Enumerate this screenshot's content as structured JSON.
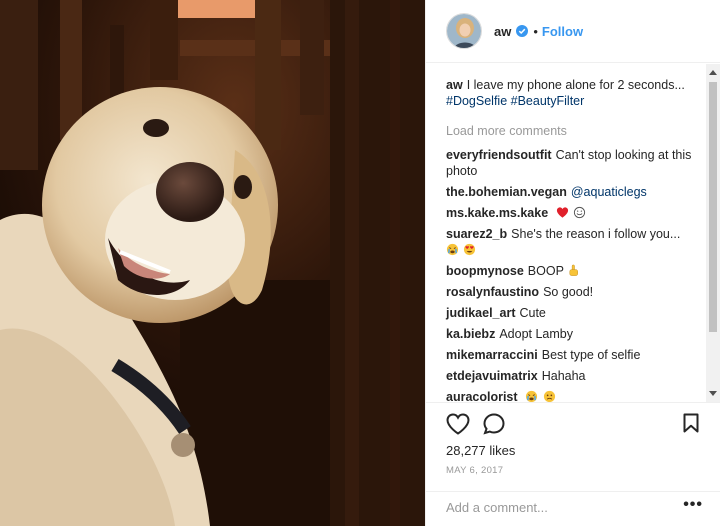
{
  "post": {
    "username": "aw",
    "follow_label": "Follow",
    "dot": "•",
    "caption_user": "aw",
    "caption_text": "I leave my phone alone for 2 seconds...",
    "hashtags": [
      "#DogSelfie",
      "#BeautyFilter"
    ],
    "load_more": "Load more comments",
    "likes": "28,277 likes",
    "date": "MAY 6, 2017",
    "add_comment_placeholder": "Add a comment...",
    "more_options": "•••"
  },
  "comments": [
    {
      "user": "everyfriendsoutfit",
      "text": "Can't stop looking at this photo"
    },
    {
      "user": "the.bohemian.vegan",
      "mention": "@aquaticlegs"
    },
    {
      "user": "ms.kake.ms.kake",
      "emojis": [
        "red-heart-emoji",
        "smile-emoji"
      ]
    },
    {
      "user": "suarez2_b",
      "text": "She's the reason i follow you...",
      "emojis": [
        "crying-emoji",
        "heart-eyes-emoji"
      ]
    },
    {
      "user": "boopmynose",
      "text": "BOOP",
      "emojis": [
        "pointing-hand-emoji"
      ]
    },
    {
      "user": "rosalynfaustino",
      "text": "So good!"
    },
    {
      "user": "judikael_art",
      "text": "Cute"
    },
    {
      "user": "ka.biebz",
      "text": "Adopt Lamby"
    },
    {
      "user": "mikemarraccini",
      "text": "Best type of selfie"
    },
    {
      "user": "etdejavuimatrix",
      "text": "Hahaha"
    },
    {
      "user": "auracolorist",
      "emojis": [
        "crying-emoji",
        "worried-emoji"
      ]
    }
  ],
  "icons": {
    "verified": "verified-badge-icon",
    "like": "heart-outline-icon",
    "comment": "comment-bubble-icon",
    "save": "bookmark-icon"
  },
  "colors": {
    "link_blue": "#3897f0",
    "hashtag": "#003569",
    "muted": "#999999",
    "text": "#262626"
  }
}
